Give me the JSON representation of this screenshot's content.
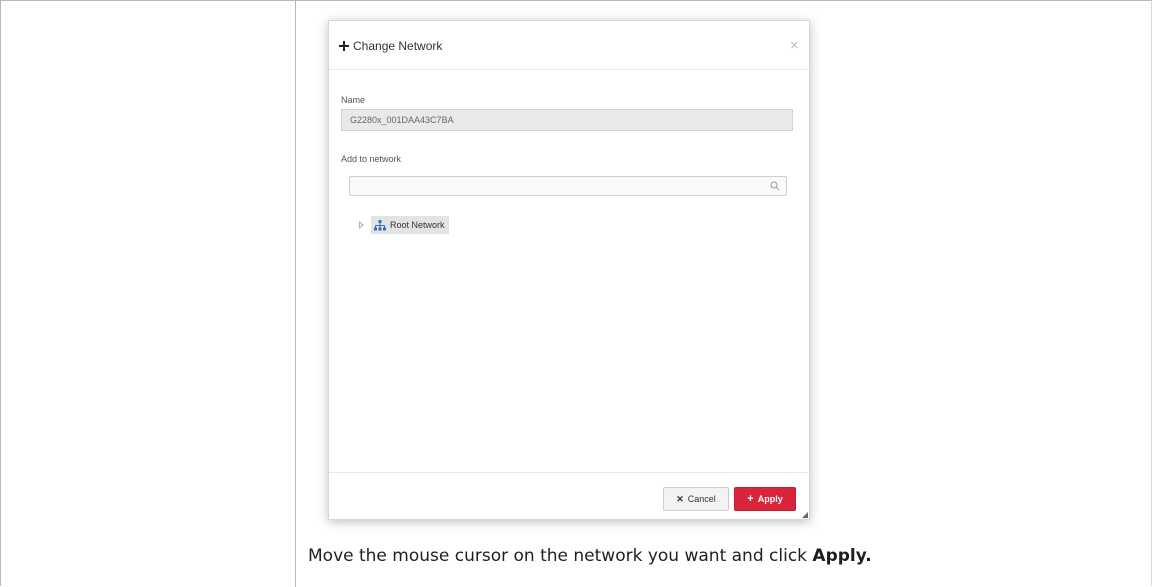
{
  "dialog": {
    "title": "Change Network",
    "close_icon": "close-icon",
    "name_label": "Name",
    "name_value": "G2280x_001DAA43C7BA",
    "add_to_network_label": "Add to network",
    "search_placeholder": "",
    "tree": [
      {
        "label": "Root Network",
        "icon": "network-icon",
        "expanded": false
      }
    ],
    "cancel_label": "Cancel",
    "apply_label": "Apply"
  },
  "caption": {
    "text": "Move the mouse cursor on the network you want and click ",
    "bold": "Apply."
  },
  "colors": {
    "apply_button": "#d9243a",
    "name_field_bg": "#e9e9e9",
    "tree_chip_bg": "#e3e3e3",
    "network_icon": "#2f6fbf"
  }
}
